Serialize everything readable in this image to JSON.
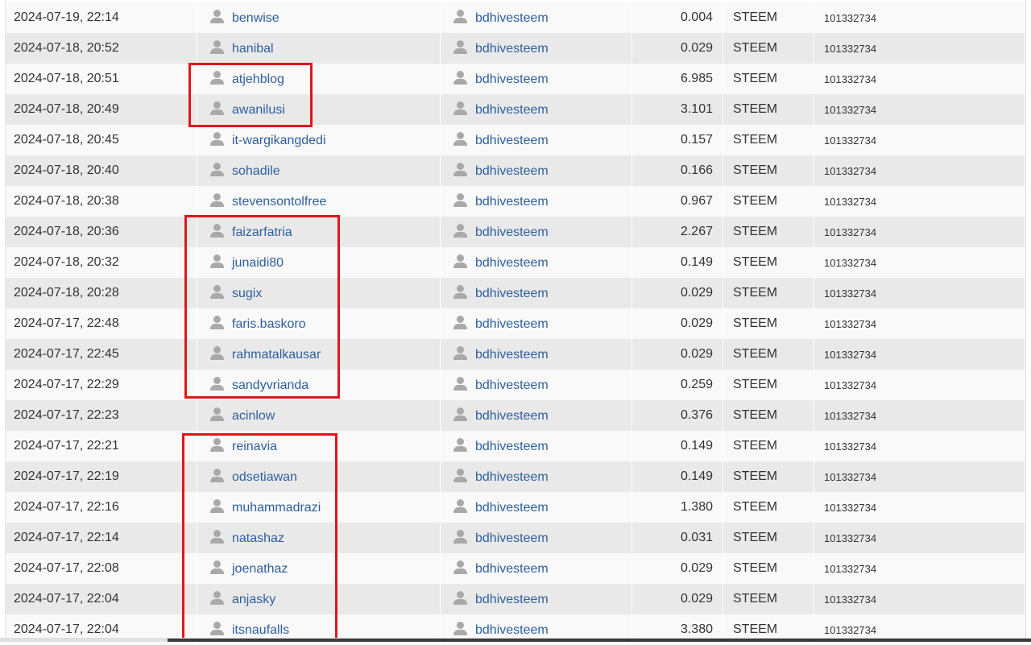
{
  "transfers": [
    {
      "date": "2024-07-19, 22:14",
      "from": "benwise",
      "to": "bdhivesteem",
      "amount": "0.004",
      "currency": "STEEM",
      "id": "101332734"
    },
    {
      "date": "2024-07-18, 20:52",
      "from": "hanibal",
      "to": "bdhivesteem",
      "amount": "0.029",
      "currency": "STEEM",
      "id": "101332734"
    },
    {
      "date": "2024-07-18, 20:51",
      "from": "atjehblog",
      "to": "bdhivesteem",
      "amount": "6.985",
      "currency": "STEEM",
      "id": "101332734"
    },
    {
      "date": "2024-07-18, 20:49",
      "from": "awanilusi",
      "to": "bdhivesteem",
      "amount": "3.101",
      "currency": "STEEM",
      "id": "101332734"
    },
    {
      "date": "2024-07-18, 20:45",
      "from": "it-wargikangdedi",
      "to": "bdhivesteem",
      "amount": "0.157",
      "currency": "STEEM",
      "id": "101332734"
    },
    {
      "date": "2024-07-18, 20:40",
      "from": "sohadile",
      "to": "bdhivesteem",
      "amount": "0.166",
      "currency": "STEEM",
      "id": "101332734"
    },
    {
      "date": "2024-07-18, 20:38",
      "from": "stevensontolfree",
      "to": "bdhivesteem",
      "amount": "0.967",
      "currency": "STEEM",
      "id": "101332734"
    },
    {
      "date": "2024-07-18, 20:36",
      "from": "faizarfatria",
      "to": "bdhivesteem",
      "amount": "2.267",
      "currency": "STEEM",
      "id": "101332734"
    },
    {
      "date": "2024-07-18, 20:32",
      "from": "junaidi80",
      "to": "bdhivesteem",
      "amount": "0.149",
      "currency": "STEEM",
      "id": "101332734"
    },
    {
      "date": "2024-07-18, 20:28",
      "from": "sugix",
      "to": "bdhivesteem",
      "amount": "0.029",
      "currency": "STEEM",
      "id": "101332734"
    },
    {
      "date": "2024-07-17, 22:48",
      "from": "faris.baskoro",
      "to": "bdhivesteem",
      "amount": "0.029",
      "currency": "STEEM",
      "id": "101332734"
    },
    {
      "date": "2024-07-17, 22:45",
      "from": "rahmatalkausar",
      "to": "bdhivesteem",
      "amount": "0.029",
      "currency": "STEEM",
      "id": "101332734"
    },
    {
      "date": "2024-07-17, 22:29",
      "from": "sandyvrianda",
      "to": "bdhivesteem",
      "amount": "0.259",
      "currency": "STEEM",
      "id": "101332734"
    },
    {
      "date": "2024-07-17, 22:23",
      "from": "acinlow",
      "to": "bdhivesteem",
      "amount": "0.376",
      "currency": "STEEM",
      "id": "101332734"
    },
    {
      "date": "2024-07-17, 22:21",
      "from": "reinavia",
      "to": "bdhivesteem",
      "amount": "0.149",
      "currency": "STEEM",
      "id": "101332734"
    },
    {
      "date": "2024-07-17, 22:19",
      "from": "odsetiawan",
      "to": "bdhivesteem",
      "amount": "0.149",
      "currency": "STEEM",
      "id": "101332734"
    },
    {
      "date": "2024-07-17, 22:16",
      "from": "muhammadrazi",
      "to": "bdhivesteem",
      "amount": "1.380",
      "currency": "STEEM",
      "id": "101332734"
    },
    {
      "date": "2024-07-17, 22:14",
      "from": "natashaz",
      "to": "bdhivesteem",
      "amount": "0.031",
      "currency": "STEEM",
      "id": "101332734"
    },
    {
      "date": "2024-07-17, 22:08",
      "from": "joenathaz",
      "to": "bdhivesteem",
      "amount": "0.029",
      "currency": "STEEM",
      "id": "101332734"
    },
    {
      "date": "2024-07-17, 22:04",
      "from": "anjasky",
      "to": "bdhivesteem",
      "amount": "0.029",
      "currency": "STEEM",
      "id": "101332734"
    },
    {
      "date": "2024-07-17, 22:04",
      "from": "itsnaufalls",
      "to": "bdhivesteem",
      "amount": "3.380",
      "currency": "STEEM",
      "id": "101332734"
    }
  ],
  "icons": {
    "user": "user-icon"
  },
  "colors": {
    "link": "#2d5f9e",
    "highlight": "#e0161b",
    "row_odd": "#f9f9f9",
    "row_even": "#e9e9e9"
  }
}
